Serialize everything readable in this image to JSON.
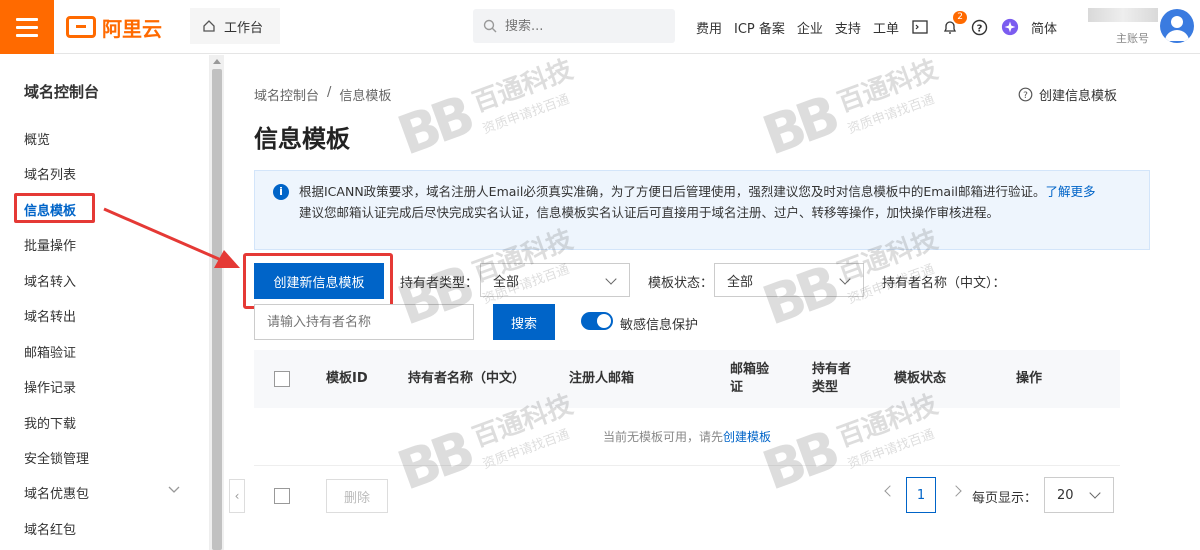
{
  "header": {
    "brand": "阿里云",
    "workbench": "工作台",
    "search_placeholder": "搜索...",
    "links": [
      "费用",
      "ICP 备案",
      "企业",
      "支持",
      "工单"
    ],
    "notification_count": "2",
    "language": "简体",
    "account_role": "主账号"
  },
  "sidebar": {
    "title": "域名控制台",
    "items": [
      "概览",
      "域名列表",
      "信息模板",
      "批量操作",
      "域名转入",
      "域名转出",
      "邮箱验证",
      "操作记录",
      "我的下载",
      "安全锁管理",
      "域名优惠包",
      "域名红包"
    ],
    "active_index": 2
  },
  "main": {
    "breadcrumb": [
      "域名控制台",
      "/",
      "信息模板"
    ],
    "create_template_link": "创建信息模板",
    "title": "信息模板",
    "notice_line1": "根据ICANN政策要求，域名注册人Email必须真实准确，为了方便日后管理使用，强烈建议您及时对信息模板中的Email邮箱进行验证。",
    "notice_link": "了解更多",
    "notice_line2": "建议您邮箱认证完成后尽快完成实名认证，信息模板实名认证后可直接用于域名注册、过户、转移等操作，加快操作审核进程。",
    "create_button": "创建新信息模板",
    "holder_type_label": "持有者类型：",
    "holder_type_value": "全部",
    "status_label": "模板状态：",
    "status_value": "全部",
    "holder_name_label": "持有者名称（中文）：",
    "holder_name_placeholder": "请输入持有者名称",
    "search_button": "搜索",
    "sensitive_label": "敏感信息保护",
    "table": {
      "columns": [
        "模板ID",
        "持有者名称（中文）",
        "注册人邮箱",
        "邮箱验证",
        "持有者类型",
        "模板状态",
        "操作"
      ],
      "empty_text": "当前无模板可用，请先",
      "empty_link": "创建模板"
    },
    "footer": {
      "delete_button": "删除",
      "current_page": "1",
      "per_page_label": "每页显示：",
      "per_page_value": "20"
    }
  },
  "watermark": {
    "name": "百通科技",
    "slogan": "资质申请找百通"
  },
  "colors": {
    "brand": "#ff6a00",
    "primary": "#0064c8",
    "annotation": "#e53935"
  }
}
